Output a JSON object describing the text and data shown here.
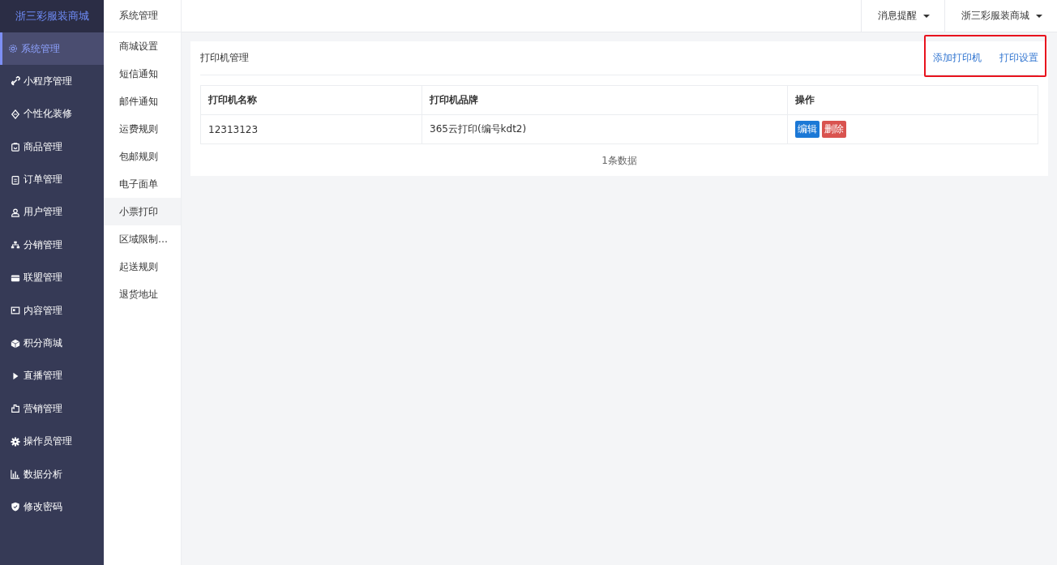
{
  "brand": "浙三彩服装商城",
  "sidebar": {
    "items": [
      {
        "label": "系统管理",
        "selected": true
      },
      {
        "label": "小程序管理",
        "selected": false
      },
      {
        "label": "个性化装修",
        "selected": false
      },
      {
        "label": "商品管理",
        "selected": false
      },
      {
        "label": "订单管理",
        "selected": false
      },
      {
        "label": "用户管理",
        "selected": false
      },
      {
        "label": "分销管理",
        "selected": false
      },
      {
        "label": "联盟管理",
        "selected": false
      },
      {
        "label": "内容管理",
        "selected": false
      },
      {
        "label": "积分商城",
        "selected": false
      },
      {
        "label": "直播管理",
        "selected": false
      },
      {
        "label": "营销管理",
        "selected": false
      },
      {
        "label": "操作员管理",
        "selected": false
      },
      {
        "label": "数据分析",
        "selected": false
      },
      {
        "label": "修改密码",
        "selected": false
      }
    ]
  },
  "submenu": {
    "title": "系统管理",
    "items": [
      {
        "label": "商城设置",
        "selected": false
      },
      {
        "label": "短信通知",
        "selected": false
      },
      {
        "label": "邮件通知",
        "selected": false
      },
      {
        "label": "运费规则",
        "selected": false
      },
      {
        "label": "包邮规则",
        "selected": false
      },
      {
        "label": "电子面单",
        "selected": false
      },
      {
        "label": "小票打印",
        "selected": true
      },
      {
        "label": "区域限制…",
        "selected": false
      },
      {
        "label": "起送规则",
        "selected": false
      },
      {
        "label": "退货地址",
        "selected": false
      }
    ]
  },
  "topbar": {
    "menus": [
      "消息提醒",
      "浙三彩服装商城"
    ]
  },
  "card": {
    "title": "打印机管理",
    "actions": [
      "添加打印机",
      "打印设置"
    ],
    "actions_highlighted": true,
    "table": {
      "columns": [
        "打印机名称",
        "打印机品牌",
        "操作"
      ],
      "rows": [
        {
          "name": "12313123",
          "brand": "365云打印(编号kdt2)",
          "buttons": [
            {
              "label": "编辑",
              "kind": "edit"
            },
            {
              "label": "删除",
              "kind": "delete"
            }
          ]
        }
      ]
    },
    "footer": "1条数据"
  }
}
